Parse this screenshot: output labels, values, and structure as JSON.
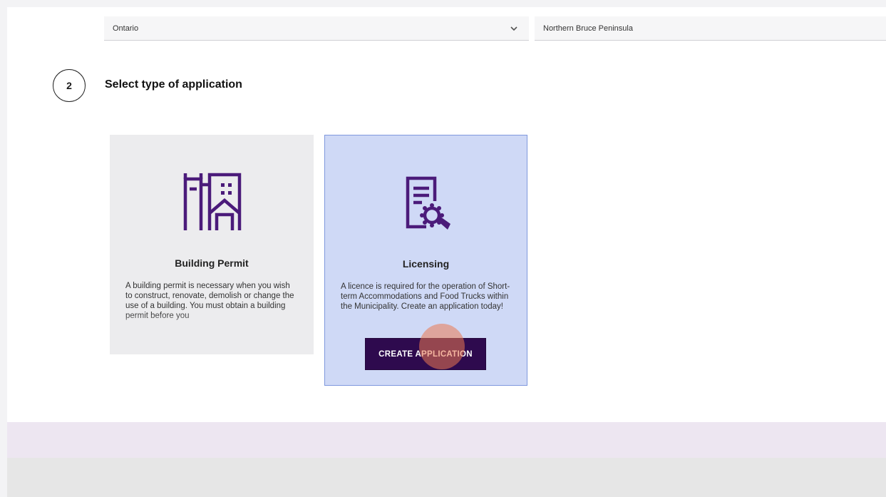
{
  "location": {
    "province": "Ontario",
    "municipality": "Northern Bruce Peninsula"
  },
  "step": {
    "number": "2",
    "title": "Select type of application"
  },
  "cards": {
    "building": {
      "title": "Building Permit",
      "description": "A building permit is necessary when you wish to construct, renovate, demolish or change the use of a building. You must obtain a building permit before you",
      "icon": "building-icon"
    },
    "licensing": {
      "title": "Licensing",
      "description": "A licence is required for the operation of Short-term Accommodations and Food Trucks within the Municipality. Create an application today!",
      "icon": "license-certificate-icon",
      "button_label": "CREATE APPLICATION"
    }
  },
  "colors": {
    "accent": "#4b1b7a",
    "button": "#2e0a4e",
    "selected_card": "#cfd9f6",
    "selected_border": "#7f98dd"
  }
}
